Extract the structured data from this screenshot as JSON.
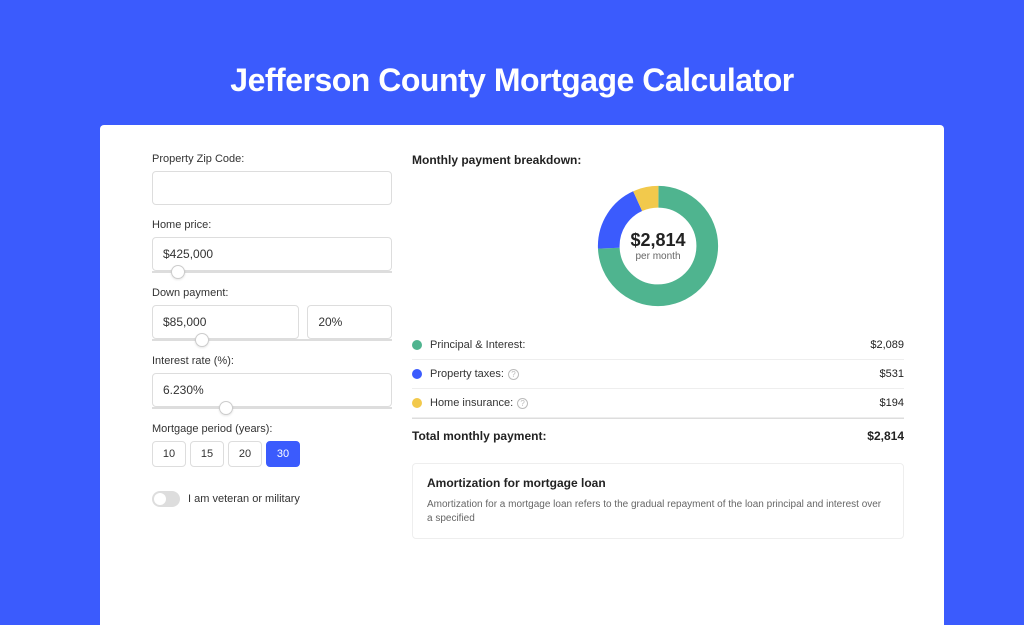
{
  "title": "Jefferson County Mortgage Calculator",
  "form": {
    "zip_label": "Property Zip Code:",
    "zip_value": "",
    "home_price_label": "Home price:",
    "home_price_value": "$425,000",
    "down_payment_label": "Down payment:",
    "down_payment_value": "$85,000",
    "down_payment_pct": "20%",
    "interest_label": "Interest rate (%):",
    "interest_value": "6.230%",
    "period_label": "Mortgage period (years):",
    "period_options": [
      "10",
      "15",
      "20",
      "30"
    ],
    "period_selected": "30",
    "veteran_label": "I am veteran or military"
  },
  "breakdown": {
    "title": "Monthly payment breakdown:",
    "center_amount": "$2,814",
    "center_sub": "per month",
    "items": [
      {
        "label": "Principal & Interest:",
        "value": "$2,089",
        "color": "#4fb48f",
        "info": false
      },
      {
        "label": "Property taxes:",
        "value": "$531",
        "color": "#3b5bfd",
        "info": true
      },
      {
        "label": "Home insurance:",
        "value": "$194",
        "color": "#f2c94c",
        "info": true
      }
    ],
    "total_label": "Total monthly payment:",
    "total_value": "$2,814"
  },
  "chart_data": {
    "type": "pie",
    "title": "Monthly payment breakdown",
    "series": [
      {
        "name": "Principal & Interest",
        "value": 2089,
        "color": "#4fb48f"
      },
      {
        "name": "Property taxes",
        "value": 531,
        "color": "#3b5bfd"
      },
      {
        "name": "Home insurance",
        "value": 194,
        "color": "#f2c94c"
      }
    ],
    "total": 2814
  },
  "amortization": {
    "title": "Amortization for mortgage loan",
    "text": "Amortization for a mortgage loan refers to the gradual repayment of the loan principal and interest over a specified"
  }
}
